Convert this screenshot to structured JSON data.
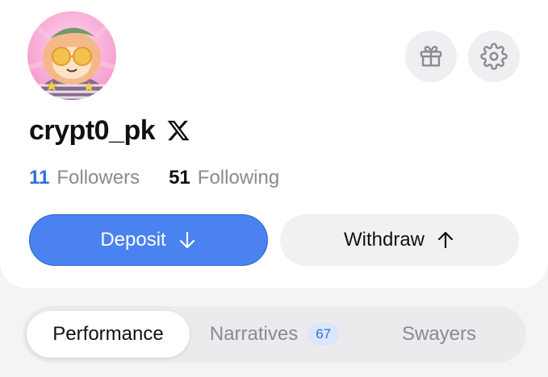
{
  "profile": {
    "username": "crypt0_pk",
    "followers_count": "11",
    "followers_label": "Followers",
    "following_count": "51",
    "following_label": "Following"
  },
  "actions": {
    "deposit_label": "Deposit",
    "withdraw_label": "Withdraw"
  },
  "tabs": [
    {
      "label": "Performance",
      "active": true
    },
    {
      "label": "Narratives",
      "badge": "67"
    },
    {
      "label": "Swayers"
    }
  ],
  "icons": {
    "gift": "gift-icon",
    "settings": "gear-icon",
    "x": "x-logo-icon",
    "deposit": "arrow-down-icon",
    "withdraw": "arrow-up-icon"
  },
  "colors": {
    "accent": "#4a82f0",
    "count_blue": "#2f6fe0",
    "badge_bg": "#dbe6fb"
  }
}
